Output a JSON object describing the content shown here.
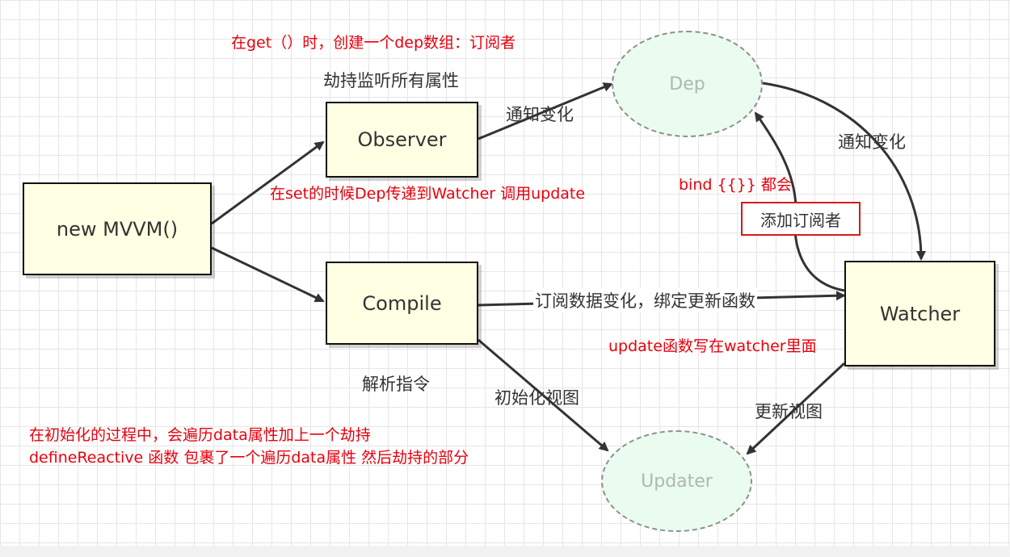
{
  "nodes": {
    "mvvm": "new MVVM()",
    "observer": "Observer",
    "compile": "Compile",
    "dep": "Dep",
    "watcher": "Watcher",
    "updater": "Updater"
  },
  "labels": {
    "hijack_all": "劫持监听所有属性",
    "notify_change_observer_dep": "通知变化",
    "notify_change_dep_watcher": "通知变化",
    "subscribe_bind": "订阅数据变化，绑定更新函数",
    "parse_directive": "解析指令",
    "init_view": "初始化视图",
    "update_view": "更新视图",
    "add_subscriber": "添加订阅者"
  },
  "annotations": {
    "get_dep": "在get（）时，创建一个dep数组：订阅者",
    "set_dep": "在set的时候Dep传递到Watcher 调用update",
    "bind_all": "bind {{}} 都会",
    "update_fn": "update函数写在watcher里面",
    "init_line1": "在初始化的过程中，会遍历data属性加上一个劫持",
    "init_line2": "defineReactive 函数 包裹了一个遍历data属性 然后劫持的部分"
  },
  "colors": {
    "box_fill": "#ffffe3",
    "ellipse_fill": "#eafbf0",
    "annotation_red": "#e8000e",
    "highlight_border": "#d61a1a"
  }
}
